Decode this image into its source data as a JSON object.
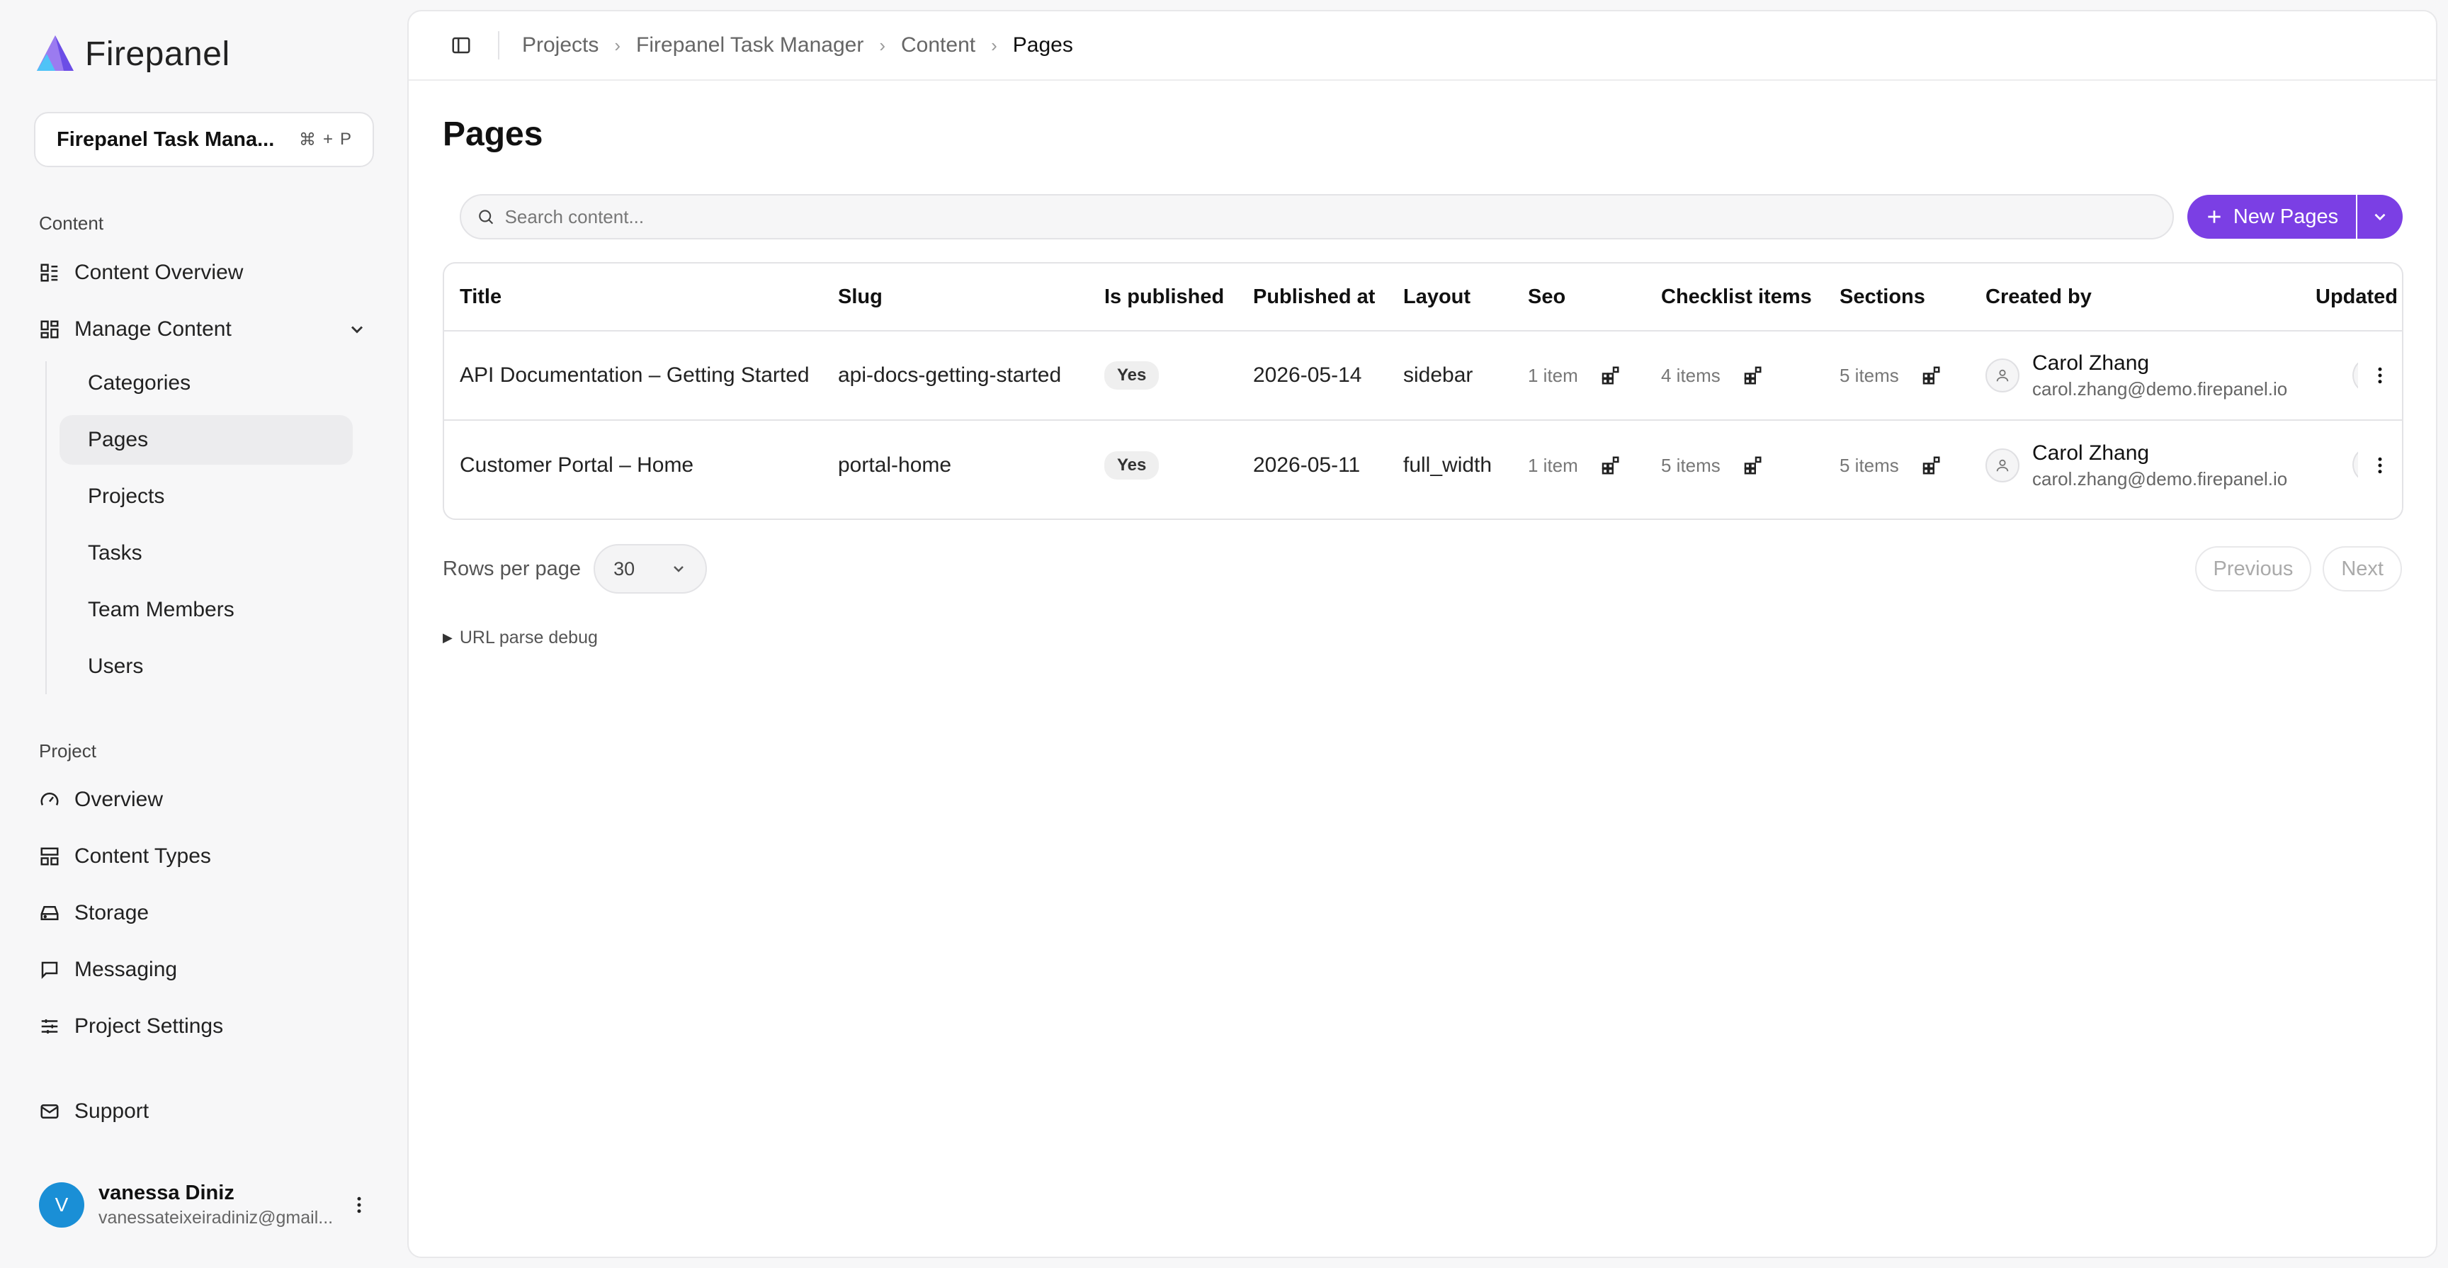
{
  "brand": {
    "name": "Firepanel"
  },
  "project_switcher": {
    "name": "Firepanel Task Mana...",
    "shortcut_mod": "⌘",
    "shortcut_plus": "+",
    "shortcut_key": "P"
  },
  "sidebar": {
    "content_heading": "Content",
    "content_overview": "Content Overview",
    "manage_content": "Manage Content",
    "sub_items": [
      "Categories",
      "Pages",
      "Projects",
      "Tasks",
      "Team Members",
      "Users"
    ],
    "project_heading": "Project",
    "project_items": [
      "Overview",
      "Content Types",
      "Storage",
      "Messaging",
      "Project Settings"
    ],
    "support": "Support"
  },
  "user": {
    "initial": "V",
    "name": "vanessa Diniz",
    "email": "vanessateixeiradiniz@gmail..."
  },
  "breadcrumb": [
    "Projects",
    "Firepanel Task Manager",
    "Content",
    "Pages"
  ],
  "page": {
    "title": "Pages"
  },
  "search": {
    "placeholder": "Search content..."
  },
  "new_button": {
    "label": "New Pages"
  },
  "table": {
    "headers": [
      "Title",
      "Slug",
      "Is published",
      "Published at",
      "Layout",
      "Seo",
      "Checklist items",
      "Sections",
      "Created by",
      "Updated"
    ],
    "rows": [
      {
        "title": "API Documentation – Getting Started",
        "slug": "api-docs-getting-started",
        "is_published": "Yes",
        "published_at": "2026-05-14",
        "layout": "sidebar",
        "seo": "1 item",
        "checklist": "4 items",
        "sections": "5 items",
        "created_name": "Carol Zhang",
        "created_email": "carol.zhang@demo.firepanel.io"
      },
      {
        "title": "Customer Portal – Home",
        "slug": "portal-home",
        "is_published": "Yes",
        "published_at": "2026-05-11",
        "layout": "full_width",
        "seo": "1 item",
        "checklist": "5 items",
        "sections": "5 items",
        "created_name": "Carol Zhang",
        "created_email": "carol.zhang@demo.firepanel.io"
      }
    ]
  },
  "pagination": {
    "rows_per_page_label": "Rows per page",
    "rows_per_page_value": "30",
    "previous": "Previous",
    "next": "Next"
  },
  "debug": {
    "label": "URL parse debug"
  },
  "colors": {
    "accent": "#7b3fe4",
    "avatar": "#1a8fd6"
  }
}
